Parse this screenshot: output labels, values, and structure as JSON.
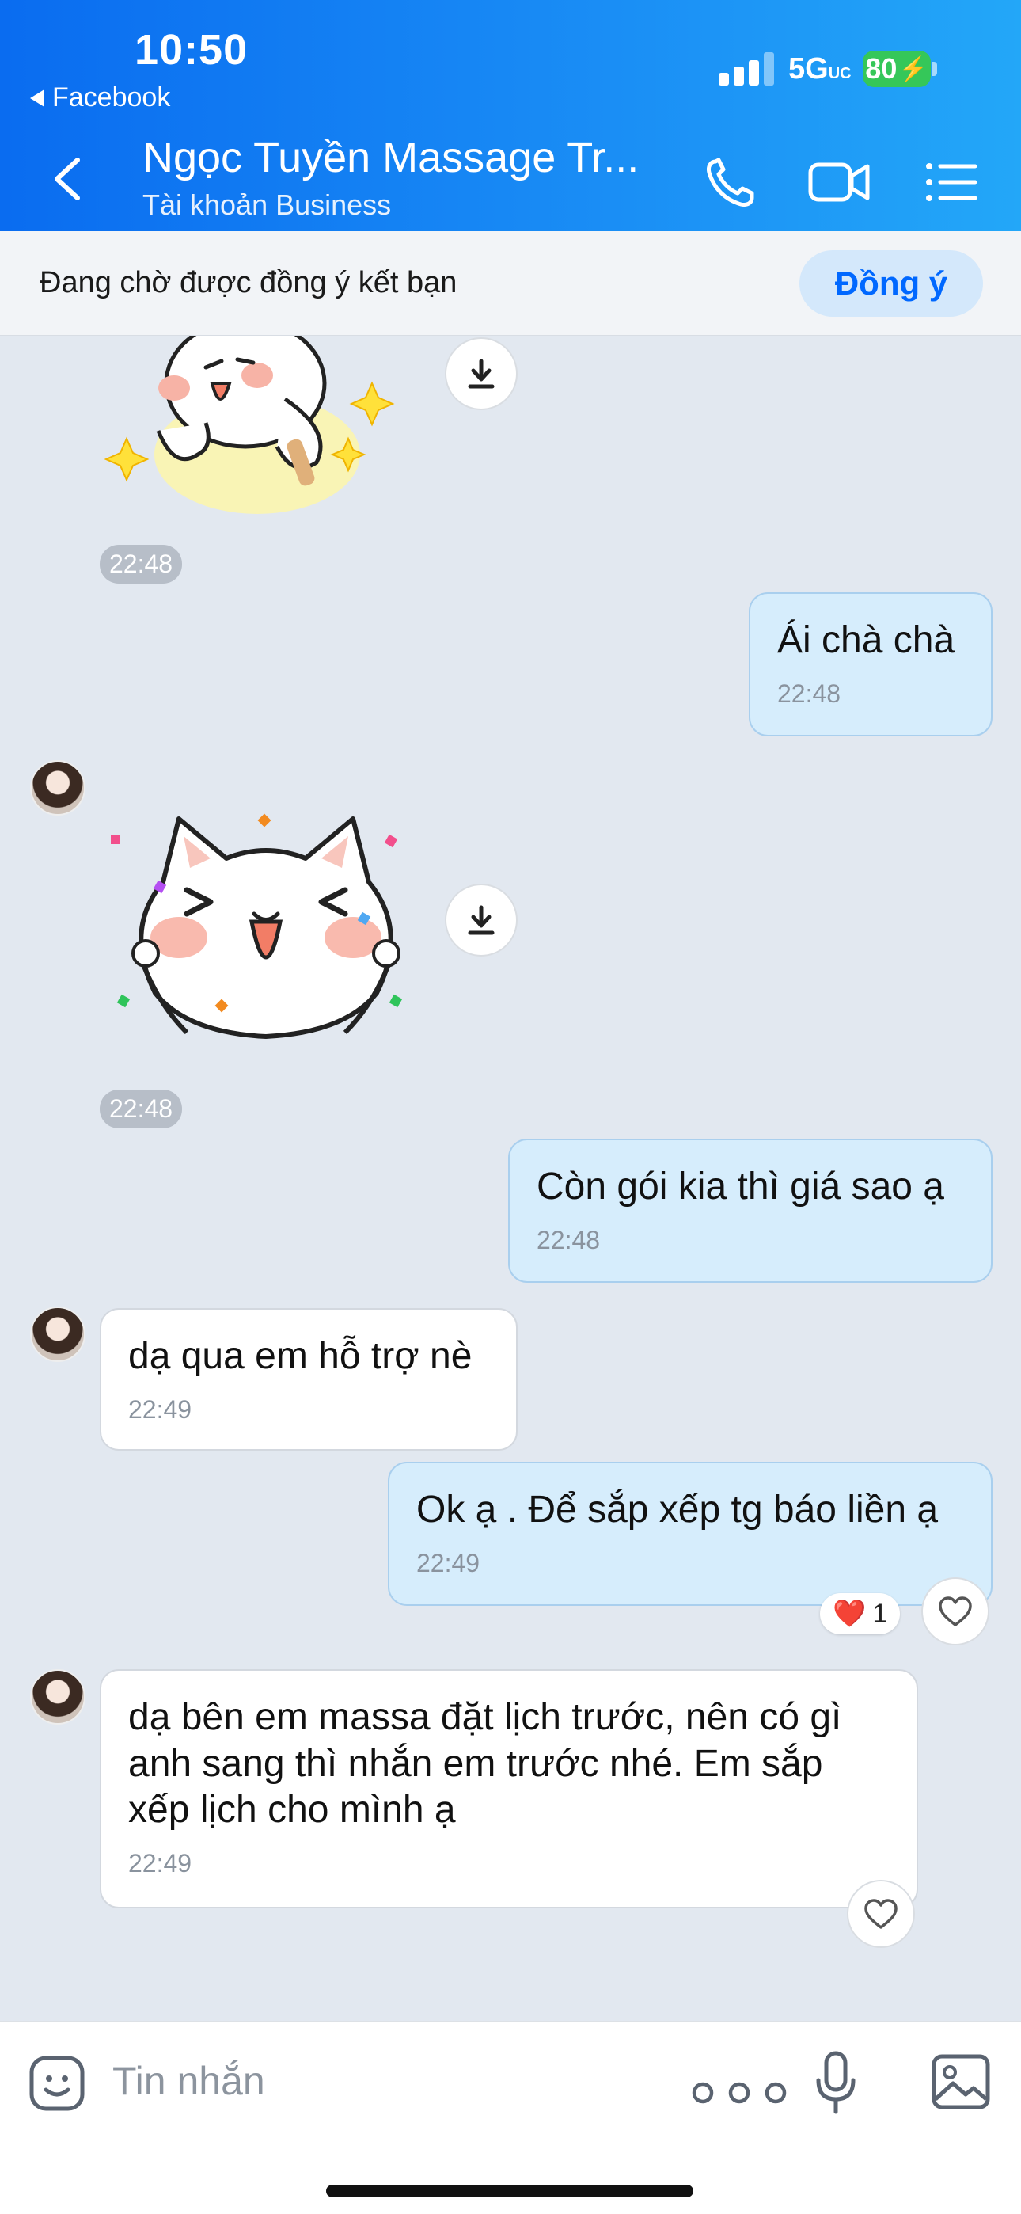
{
  "status": {
    "time": "10:50",
    "back_app": "Facebook",
    "network": "5G",
    "network_sub": "UC",
    "battery": "80"
  },
  "header": {
    "title": "Ngọc Tuyền Massage Tr...",
    "subtitle": "Tài khoản Business"
  },
  "friend_request": {
    "text": "Đang chờ được đồng ý kết bạn",
    "accept_label": "Đồng ý"
  },
  "messages": [
    {
      "type": "sticker",
      "from": "them",
      "sticker": "cat-sparkle-sticker",
      "time": "22:48"
    },
    {
      "type": "text",
      "from": "me",
      "text": "Ái chà chà",
      "time": "22:48"
    },
    {
      "type": "sticker",
      "from": "them",
      "sticker": "cat-laughing-sticker",
      "time": "22:48"
    },
    {
      "type": "text",
      "from": "me",
      "text": "Còn gói kia thì giá sao ạ",
      "time": "22:48"
    },
    {
      "type": "text",
      "from": "them",
      "text": "dạ qua em hỗ trợ nè",
      "time": "22:49"
    },
    {
      "type": "text",
      "from": "me",
      "text": "Ok ạ . Để sắp xếp tg báo liền ạ",
      "time": "22:49",
      "reaction": {
        "emoji": "❤️",
        "count": "1"
      }
    },
    {
      "type": "text",
      "from": "them",
      "text": "dạ bên em massa đặt lịch trước, nên có gì anh sang thì nhắn em trước nhé. Em sắp xếp lịch cho mình ạ",
      "time": "22:49"
    }
  ],
  "input": {
    "placeholder": "Tin nhắn"
  },
  "colors": {
    "header_start": "#0a6cf0",
    "header_end": "#23a7f8",
    "accent": "#0068ff",
    "outgoing_bubble": "#d6edfc",
    "chat_bg": "#e2e8f0"
  }
}
